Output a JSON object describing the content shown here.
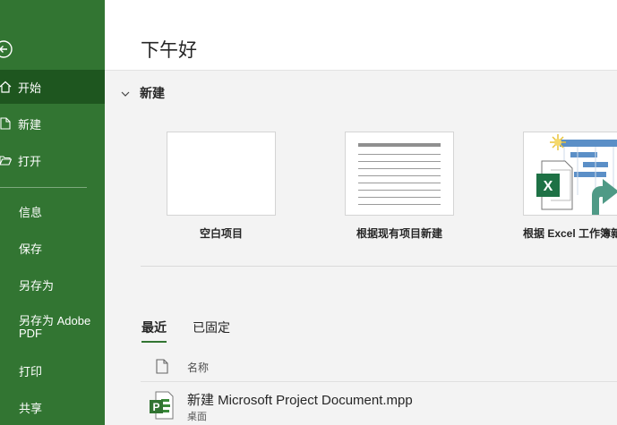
{
  "header": {
    "greeting": "下午好"
  },
  "sidebar": {
    "items": [
      {
        "label": "开始"
      },
      {
        "label": "新建"
      },
      {
        "label": "打开"
      },
      {
        "label": "信息"
      },
      {
        "label": "保存"
      },
      {
        "label": "另存为"
      },
      {
        "label": "另存为 Adobe PDF"
      },
      {
        "label": "打印"
      },
      {
        "label": "共享"
      }
    ]
  },
  "new_section": {
    "title": "新建",
    "templates": [
      {
        "label": "空白项目"
      },
      {
        "label": "根据现有项目新建"
      },
      {
        "label": "根据 Excel 工作簿新建"
      }
    ]
  },
  "tabs": [
    {
      "label": "最近"
    },
    {
      "label": "已固定"
    }
  ],
  "list": {
    "column_name": "名称",
    "files": [
      {
        "name": "新建 Microsoft Project Document.mpp",
        "location": "桌面"
      }
    ]
  },
  "colors": {
    "sidebar": "#327532",
    "sidebar_active": "#1e561f",
    "accent": "#327532"
  }
}
